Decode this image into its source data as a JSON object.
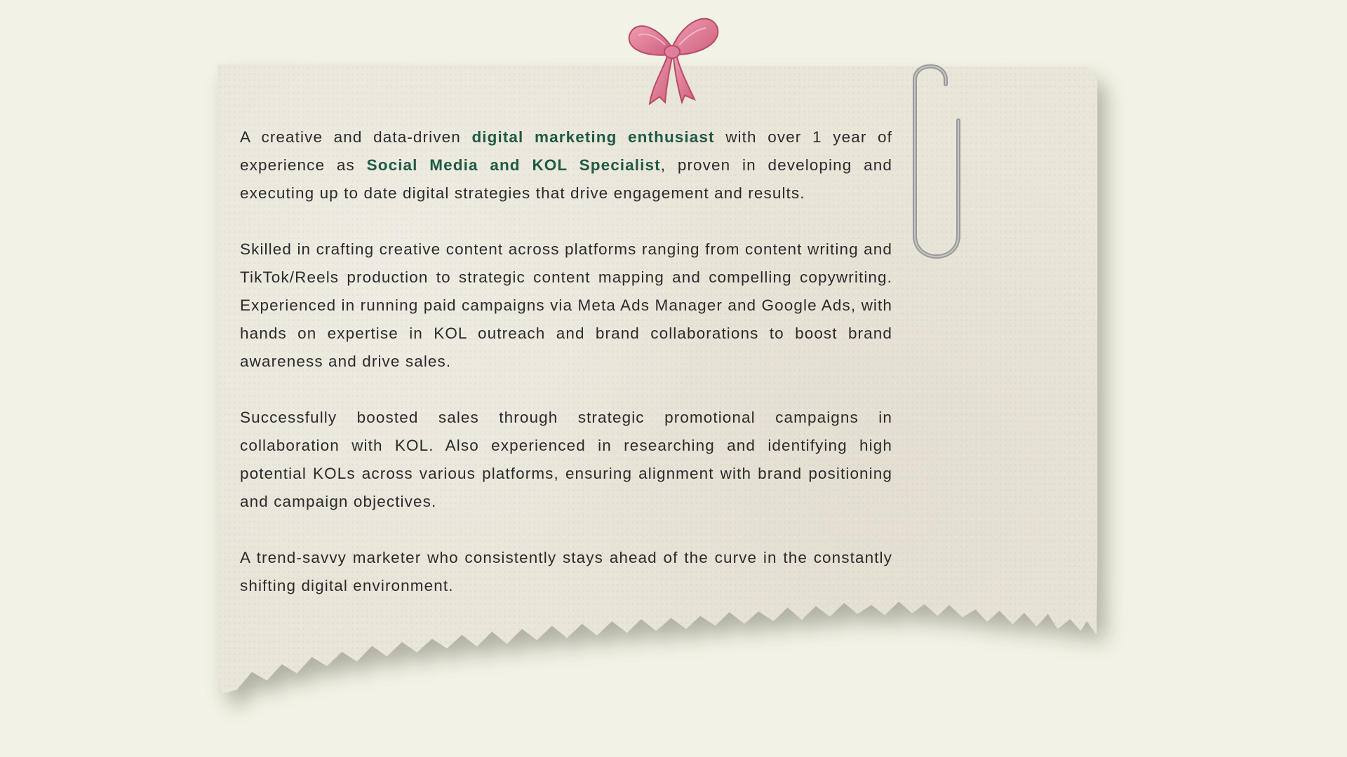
{
  "paragraphs": [
    {
      "segments": [
        {
          "text": "A creative and data-driven ",
          "emphasis": false
        },
        {
          "text": "digital marketing enthusiast",
          "emphasis": true
        },
        {
          "text": " with over 1 year of experience as ",
          "emphasis": false
        },
        {
          "text": "Social Media and KOL Specialist",
          "emphasis": true
        },
        {
          "text": ", proven in developing and executing up to date digital strategies that drive engagement and results.",
          "emphasis": false
        }
      ]
    },
    {
      "segments": [
        {
          "text": "Skilled in crafting creative content across platforms ranging from content writing and TikTok/Reels production to strategic content mapping and compelling copywriting. Experienced in running paid campaigns via Meta Ads Manager and Google Ads, with hands on expertise in KOL outreach and brand collaborations to boost brand awareness and drive sales.",
          "emphasis": false
        }
      ]
    },
    {
      "segments": [
        {
          "text": "Successfully boosted sales through strategic promotional campaigns in collaboration with KOL. Also experienced in researching and identifying high potential KOLs across various platforms, ensuring alignment with brand positioning and campaign objectives.",
          "emphasis": false
        }
      ]
    },
    {
      "segments": [
        {
          "text": "A trend-savvy marketer who consistently stays ahead of the curve in the constantly shifting digital environment.",
          "emphasis": false
        }
      ]
    }
  ],
  "colors": {
    "background": "#f2f2e6",
    "paper": "#e9e5d9",
    "body_text": "#2b2b2b",
    "highlight_text": "#1f5a43",
    "bow": "#d96b86",
    "paperclip": "#8f8f8f"
  },
  "decorations": {
    "bow_icon": "ribbon-bow-icon",
    "clip_icon": "paperclip-icon"
  }
}
